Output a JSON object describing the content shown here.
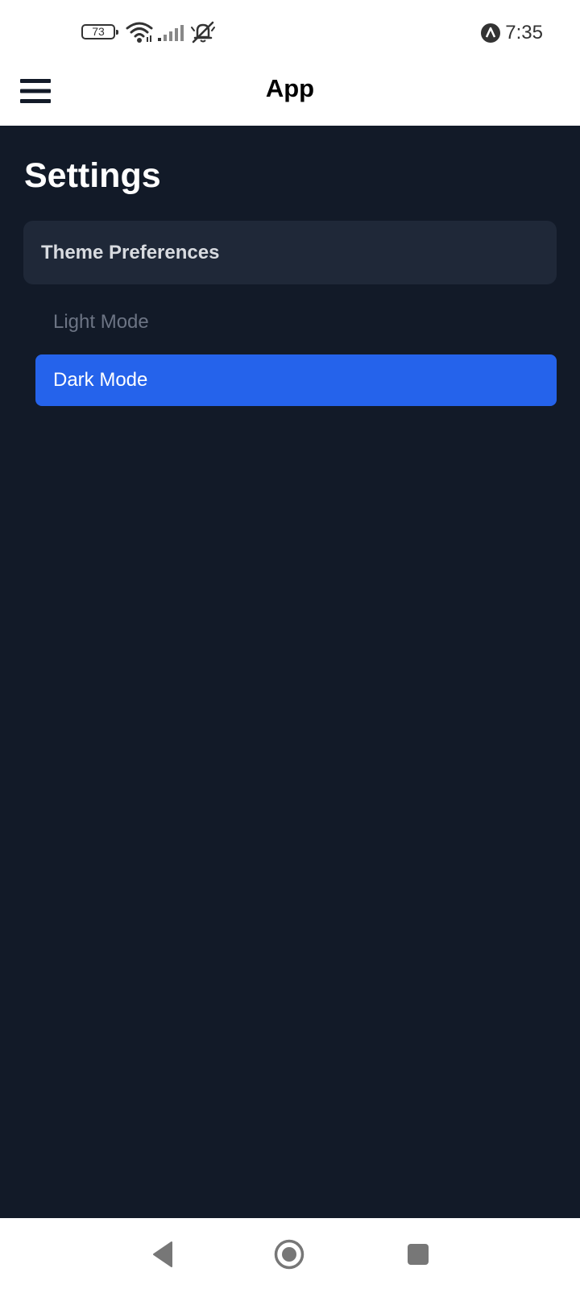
{
  "status_bar": {
    "battery_level": "73",
    "time": "7:35",
    "icons": [
      "wifi-icon",
      "cellular-signal-icon",
      "notifications-off-icon",
      "app-notification-icon"
    ]
  },
  "app_bar": {
    "title": "App",
    "menu_icon": "hamburger-menu-icon"
  },
  "main": {
    "title": "Settings",
    "section": {
      "title": "Theme Preferences",
      "options": [
        {
          "label": "Light Mode",
          "selected": false
        },
        {
          "label": "Dark Mode",
          "selected": true
        }
      ]
    }
  },
  "nav_bar": {
    "icons": [
      "back-icon",
      "home-icon",
      "recents-icon"
    ]
  },
  "colors": {
    "background": "#121a28",
    "section_bg": "#1f2838",
    "accent": "#2563eb",
    "muted_text": "#6c7484"
  }
}
